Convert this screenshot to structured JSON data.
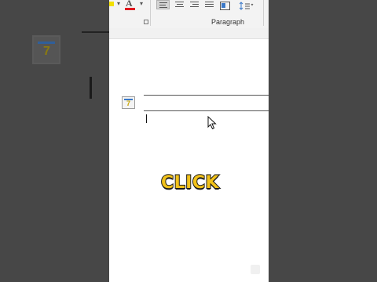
{
  "ribbon": {
    "group_label": "Paragraph"
  },
  "caption": {
    "text": "CLICK"
  },
  "icons": {
    "font_color": "font-color-icon",
    "align_left": "align-left-icon",
    "align_center": "align-center-icon",
    "align_right": "align-right-icon",
    "justify": "justify-icon",
    "line_spacing": "line-spacing-icon",
    "dialog_launcher": "dialog-launcher-icon",
    "field_placeholder": "field-placeholder-icon",
    "mouse_pointer": "mouse-pointer-icon"
  },
  "colors": {
    "caption_fill": "#f2c21a",
    "font_color_bar": "#e0171f",
    "page_background": "#ffffff",
    "side_dim": "#474747"
  }
}
